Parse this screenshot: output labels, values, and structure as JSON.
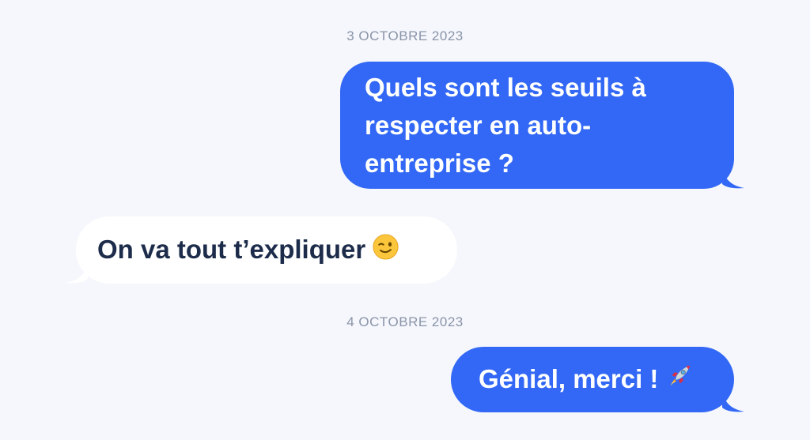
{
  "conversation": {
    "date_1": "3 OCTOBRE 2023",
    "message_1": "Quels sont les seuils à respecter en auto-entreprise ?",
    "message_2": "On va tout t’expliquer",
    "message_2_emoji": "winking-face-emoji",
    "date_2": "4 OCTOBRE 2023",
    "message_3": "Génial, merci !",
    "message_3_emoji": "rocket-emoji"
  },
  "colors": {
    "background": "#f5f7fc",
    "sent_bubble": "#3268f5",
    "received_bubble": "#ffffff",
    "received_text": "#1d2c4a",
    "date_text": "#8a94a8"
  }
}
